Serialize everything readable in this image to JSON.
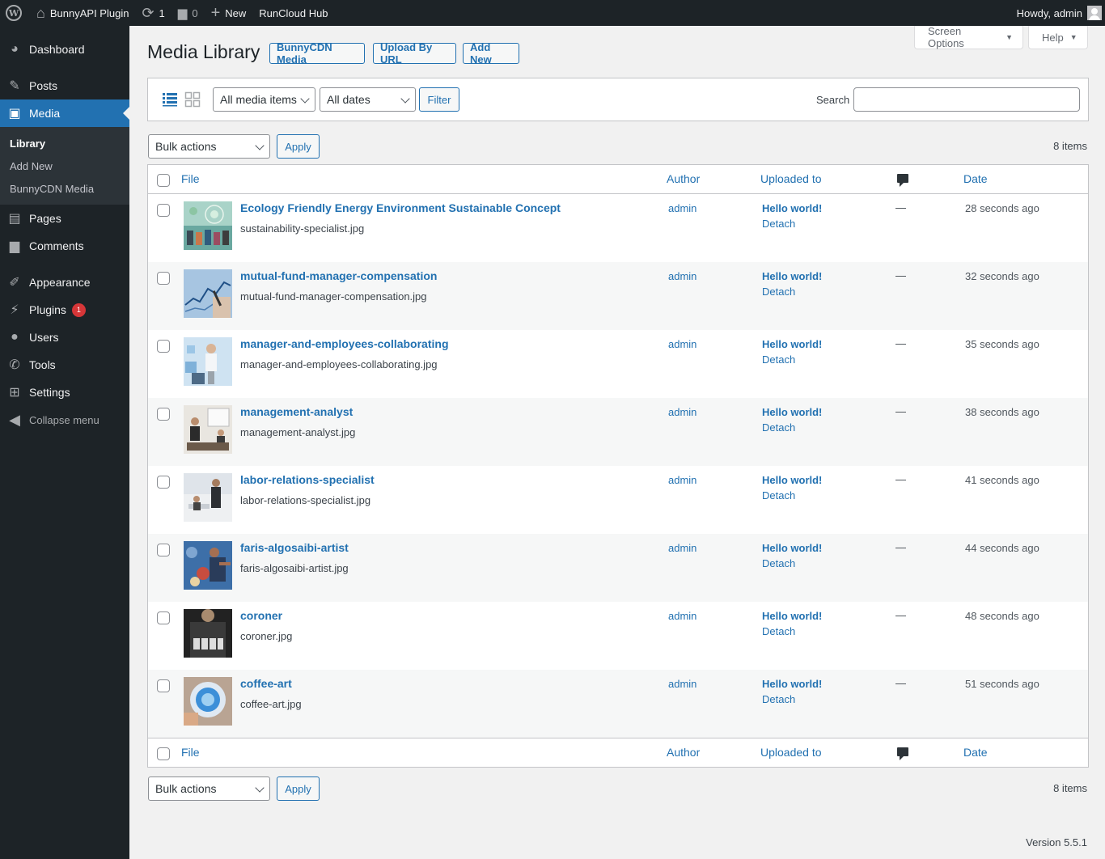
{
  "adminbar": {
    "site_name": "BunnyAPI Plugin",
    "updates_count": "1",
    "comments_count": "0",
    "new_label": "New",
    "runcloud_label": "RunCloud Hub",
    "howdy": "Howdy, admin"
  },
  "sidebar": {
    "items": [
      {
        "label": "Dashboard",
        "icon": "dashboard-icon"
      },
      {
        "label": "Posts",
        "icon": "pin-icon"
      },
      {
        "label": "Media",
        "icon": "media-icon"
      },
      {
        "label": "Pages",
        "icon": "pages-icon"
      },
      {
        "label": "Comments",
        "icon": "comments-icon"
      },
      {
        "label": "Appearance",
        "icon": "brush-icon"
      },
      {
        "label": "Plugins",
        "icon": "plugin-icon",
        "badge": "1"
      },
      {
        "label": "Users",
        "icon": "users-icon"
      },
      {
        "label": "Tools",
        "icon": "wrench-icon"
      },
      {
        "label": "Settings",
        "icon": "settings-icon"
      }
    ],
    "submenu": [
      "Library",
      "Add New",
      "BunnyCDN Media"
    ],
    "collapse": "Collapse menu"
  },
  "screen_options": "Screen Options",
  "help": "Help",
  "page_title": "Media Library",
  "actions": {
    "bunnycdn": "BunnyCDN Media",
    "upload_url": "Upload By URL",
    "add_new": "Add New"
  },
  "filters": {
    "media_type": "All media items",
    "dates": "All dates",
    "filter_button": "Filter",
    "search_label": "Search",
    "search_value": ""
  },
  "bulk": {
    "label": "Bulk actions",
    "apply": "Apply",
    "items_count": "8 items"
  },
  "columns": {
    "file": "File",
    "author": "Author",
    "uploaded_to": "Uploaded to",
    "date": "Date"
  },
  "rows": [
    {
      "title": "Ecology Friendly Energy Environment Sustainable Concept",
      "file": "sustainability-specialist.jpg",
      "author": "admin",
      "parent": "Hello world!",
      "detach": "Detach",
      "comments": "—",
      "date": "28 seconds ago"
    },
    {
      "title": "mutual-fund-manager-compensation",
      "file": "mutual-fund-manager-compensation.jpg",
      "author": "admin",
      "parent": "Hello world!",
      "detach": "Detach",
      "comments": "—",
      "date": "32 seconds ago"
    },
    {
      "title": "manager-and-employees-collaborating",
      "file": "manager-and-employees-collaborating.jpg",
      "author": "admin",
      "parent": "Hello world!",
      "detach": "Detach",
      "comments": "—",
      "date": "35 seconds ago"
    },
    {
      "title": "management-analyst",
      "file": "management-analyst.jpg",
      "author": "admin",
      "parent": "Hello world!",
      "detach": "Detach",
      "comments": "—",
      "date": "38 seconds ago"
    },
    {
      "title": "labor-relations-specialist",
      "file": "labor-relations-specialist.jpg",
      "author": "admin",
      "parent": "Hello world!",
      "detach": "Detach",
      "comments": "—",
      "date": "41 seconds ago"
    },
    {
      "title": "faris-algosaibi-artist",
      "file": "faris-algosaibi-artist.jpg",
      "author": "admin",
      "parent": "Hello world!",
      "detach": "Detach",
      "comments": "—",
      "date": "44 seconds ago"
    },
    {
      "title": "coroner",
      "file": "coroner.jpg",
      "author": "admin",
      "parent": "Hello world!",
      "detach": "Detach",
      "comments": "—",
      "date": "48 seconds ago"
    },
    {
      "title": "coffee-art",
      "file": "coffee-art.jpg",
      "author": "admin",
      "parent": "Hello world!",
      "detach": "Detach",
      "comments": "—",
      "date": "51 seconds ago"
    }
  ],
  "version": "Version 5.5.1",
  "colors": {
    "accent": "#2271b1",
    "sidebar": "#1d2327",
    "badge": "#d63638"
  }
}
